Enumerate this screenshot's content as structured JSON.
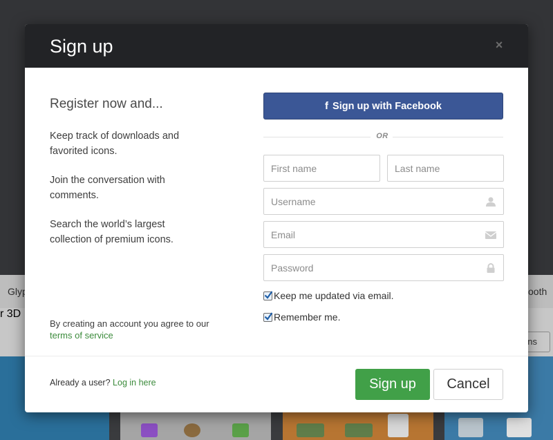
{
  "background": {
    "tab_left": "Glyp",
    "tab_right": "ooth",
    "heading_partial": "r 3D",
    "button_partial": "ons"
  },
  "modal": {
    "title": "Sign up",
    "close_symbol": "×",
    "left": {
      "heading": "Register now and...",
      "benefits": [
        "Keep track of downloads and favorited icons.",
        "Join the conversation with comments.",
        "Search the world’s largest collection of premium icons."
      ],
      "agree_text": "By creating an account you agree to our",
      "terms_link": "terms of service"
    },
    "right": {
      "facebook_icon": "f",
      "facebook_label": "Sign up with Facebook",
      "or_text": "OR",
      "first_name_placeholder": "First name",
      "last_name_placeholder": "Last name",
      "username_placeholder": "Username",
      "email_placeholder": "Email",
      "password_placeholder": "Password",
      "checkboxes": [
        {
          "label": "Keep me updated via email.",
          "checked": true
        },
        {
          "label": "Remember me.",
          "checked": true
        }
      ]
    },
    "footer": {
      "already_text": "Already a user?",
      "login_link": "Log in here",
      "signup_label": "Sign up",
      "cancel_label": "Cancel"
    }
  },
  "colors": {
    "header_bg": "#222326",
    "facebook_blue": "#3b5796",
    "signup_green": "#41a048",
    "link_green": "#3c8b3c"
  },
  "icons": [
    "close-icon",
    "facebook-icon",
    "user-icon",
    "envelope-icon",
    "lock-icon",
    "checkmark-icon"
  ]
}
